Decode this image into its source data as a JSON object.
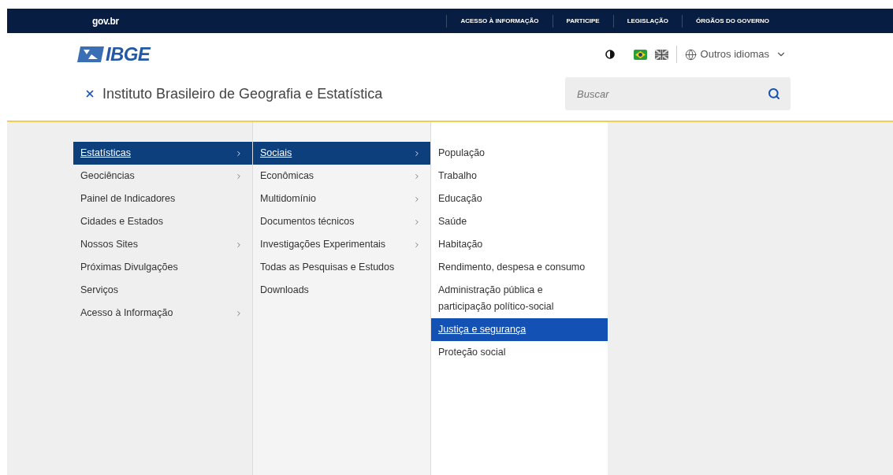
{
  "top_bar": {
    "brand": "gov.br",
    "links": [
      "ACESSO À INFORMAÇÃO",
      "PARTICIPE",
      "LEGISLAÇÃO",
      "ÓRGÃOS DO GOVERNO"
    ]
  },
  "header": {
    "logo": "IBGE",
    "language_menu": "Outros idiomas",
    "site_title": "Instituto Brasileiro de Geografia e Estatística",
    "search": {
      "placeholder": "Buscar"
    }
  },
  "menu_columns": [
    {
      "items": [
        {
          "label": "Estatísticas",
          "selected": true,
          "has_submenu": true
        },
        {
          "label": "Geociências",
          "selected": false,
          "has_submenu": true
        },
        {
          "label": "Painel de Indicadores",
          "selected": false,
          "has_submenu": false
        },
        {
          "label": "Cidades e Estados",
          "selected": false,
          "has_submenu": false
        },
        {
          "label": "Nossos Sites",
          "selected": false,
          "has_submenu": true
        },
        {
          "label": "Próximas Divulgações",
          "selected": false,
          "has_submenu": false
        },
        {
          "label": "Serviços",
          "selected": false,
          "has_submenu": false
        },
        {
          "label": "Acesso à Informação",
          "selected": false,
          "has_submenu": true
        }
      ]
    },
    {
      "items": [
        {
          "label": "Sociais",
          "selected": true,
          "has_submenu": true
        },
        {
          "label": "Econômicas",
          "selected": false,
          "has_submenu": true
        },
        {
          "label": "Multidomínio",
          "selected": false,
          "has_submenu": true
        },
        {
          "label": "Documentos técnicos",
          "selected": false,
          "has_submenu": true
        },
        {
          "label": "Investigações Experimentais",
          "selected": false,
          "has_submenu": true
        },
        {
          "label": "Todas as Pesquisas e Estudos",
          "selected": false,
          "has_submenu": false
        },
        {
          "label": "Downloads",
          "selected": false,
          "has_submenu": false
        }
      ]
    },
    {
      "items": [
        {
          "label": "População",
          "selected": false,
          "has_submenu": false
        },
        {
          "label": "Trabalho",
          "selected": false,
          "has_submenu": false
        },
        {
          "label": "Educação",
          "selected": false,
          "has_submenu": false
        },
        {
          "label": "Saúde",
          "selected": false,
          "has_submenu": false
        },
        {
          "label": "Habitação",
          "selected": false,
          "has_submenu": false
        },
        {
          "label": "Rendimento, despesa e consumo",
          "selected": false,
          "has_submenu": false
        },
        {
          "label": "Administração pública e participação político-social",
          "selected": false,
          "has_submenu": false
        },
        {
          "label": "Justiça e segurança",
          "selected": true,
          "has_submenu": false
        },
        {
          "label": "Proteção social",
          "selected": false,
          "has_submenu": false
        }
      ]
    }
  ]
}
